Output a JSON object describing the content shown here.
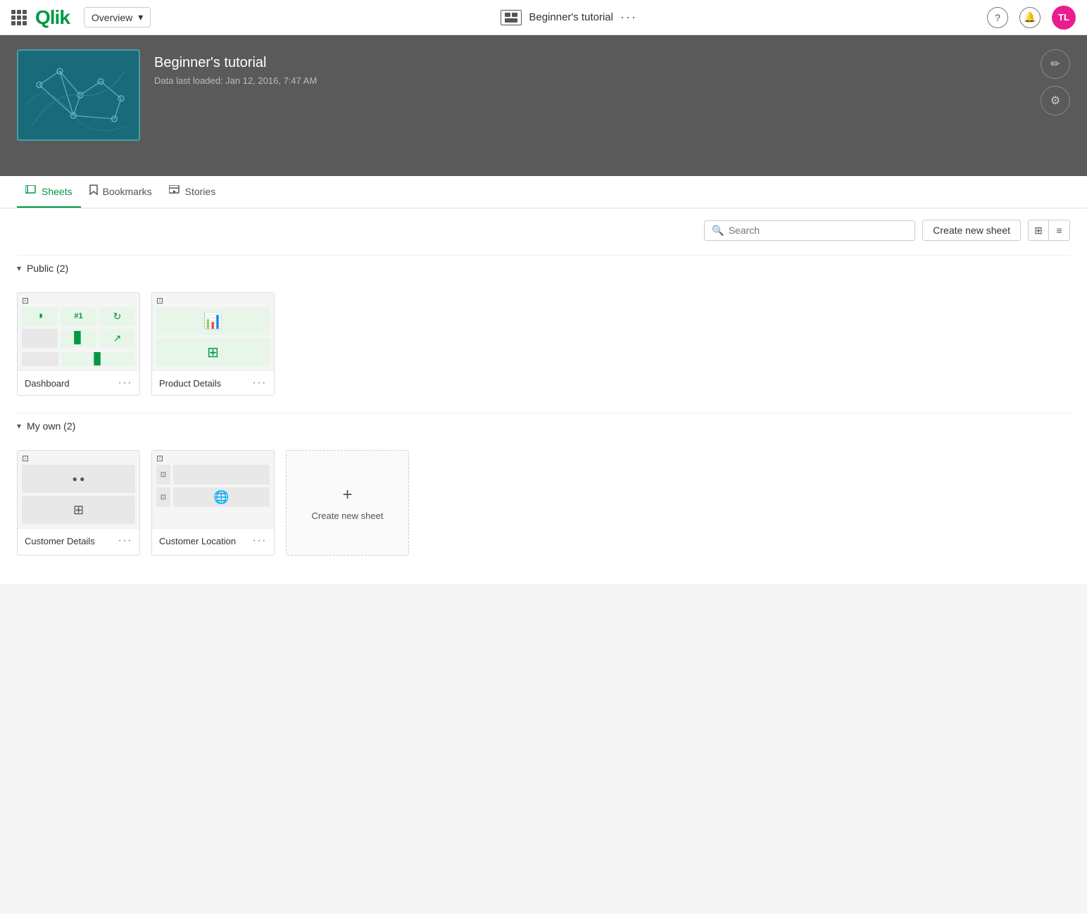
{
  "nav": {
    "logo": "Qlik",
    "dropdown_label": "Overview",
    "app_title": "Beginner's tutorial",
    "more_label": "···",
    "help_icon": "?",
    "notification_icon": "🔔",
    "avatar_initials": "TL"
  },
  "hero": {
    "title": "Beginner's tutorial",
    "subtitle": "Data last loaded: Jan 12, 2016, 7:47 AM",
    "edit_icon": "✏",
    "settings_icon": "⚙"
  },
  "tabs": [
    {
      "id": "sheets",
      "label": "Sheets",
      "active": true
    },
    {
      "id": "bookmarks",
      "label": "Bookmarks",
      "active": false
    },
    {
      "id": "stories",
      "label": "Stories",
      "active": false
    }
  ],
  "toolbar": {
    "search_placeholder": "Search",
    "create_sheet_label": "Create new sheet",
    "grid_view_icon": "⊞",
    "list_view_icon": "≡"
  },
  "sections": [
    {
      "id": "public",
      "label": "Public (2)",
      "expanded": true,
      "sheets": [
        {
          "id": "dashboard",
          "name": "Dashboard",
          "layout": "multi"
        },
        {
          "id": "product-details",
          "name": "Product Details",
          "layout": "two-col"
        }
      ]
    },
    {
      "id": "my-own",
      "label": "My own (2)",
      "expanded": true,
      "sheets": [
        {
          "id": "customer-details",
          "name": "Customer Details",
          "layout": "two-row"
        },
        {
          "id": "customer-location",
          "name": "Customer Location",
          "layout": "globe"
        }
      ]
    }
  ],
  "create_new_sheet": {
    "plus_icon": "+",
    "label": "Create new sheet"
  }
}
